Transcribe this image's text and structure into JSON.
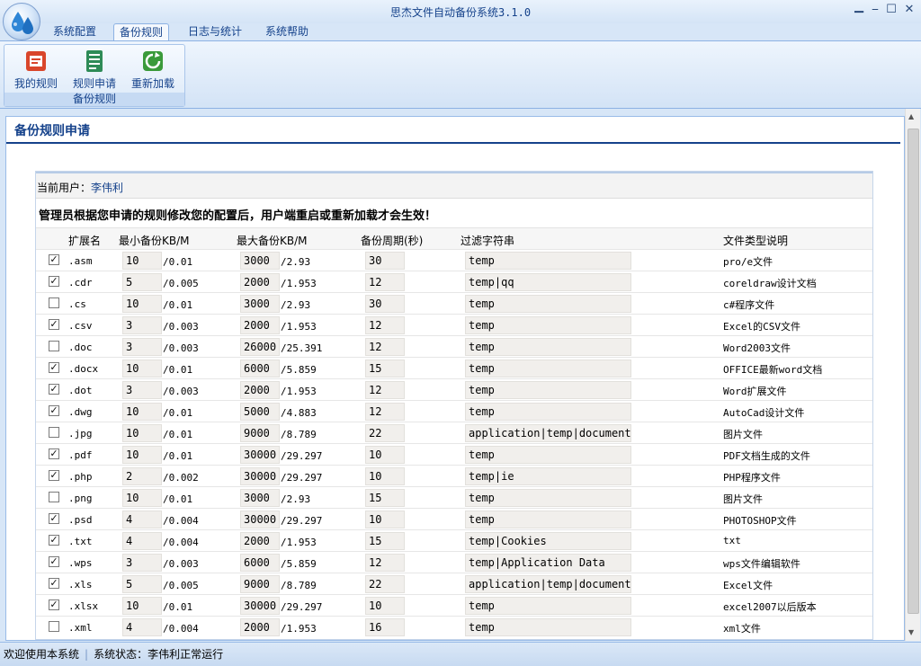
{
  "window": {
    "title": "思杰文件自动备份系统3.1.0"
  },
  "menu": {
    "tabs": [
      {
        "label": "系统配置",
        "active": false
      },
      {
        "label": "备份规则",
        "active": true
      },
      {
        "label": "日志与统计",
        "active": false
      },
      {
        "label": "系统帮助",
        "active": false
      }
    ]
  },
  "ribbon": {
    "group_label": "备份规则",
    "buttons": [
      {
        "label": "我的规则",
        "icon": "my-rules-icon"
      },
      {
        "label": "规则申请",
        "icon": "rule-apply-icon"
      },
      {
        "label": "重新加载",
        "icon": "reload-icon"
      }
    ]
  },
  "page": {
    "title": "备份规则申请",
    "user_label": "当前用户：",
    "user_name": "李伟利",
    "notice": "管理员根据您申请的规则修改您的配置后，用户端重启或重新加载才会生效！"
  },
  "table": {
    "headers": [
      "扩展名",
      "最小备份KB/M",
      "最大备份KB/M",
      "备份周期(秒)",
      "过滤字符串",
      "文件类型说明"
    ],
    "rows": [
      {
        "checked": true,
        "ext": ".asm",
        "min": "10",
        "min_m": "/0.01",
        "max": "3000",
        "max_m": "/2.93",
        "period": "30",
        "filter": "temp",
        "desc": "pro/e文件"
      },
      {
        "checked": true,
        "ext": ".cdr",
        "min": "5",
        "min_m": "/0.005",
        "max": "2000",
        "max_m": "/1.953",
        "period": "12",
        "filter": "temp|qq",
        "desc": "coreldraw设计文档"
      },
      {
        "checked": false,
        "ext": ".cs",
        "min": "10",
        "min_m": "/0.01",
        "max": "3000",
        "max_m": "/2.93",
        "period": "30",
        "filter": "temp",
        "desc": "c#程序文件"
      },
      {
        "checked": true,
        "ext": ".csv",
        "min": "3",
        "min_m": "/0.003",
        "max": "2000",
        "max_m": "/1.953",
        "period": "12",
        "filter": "temp",
        "desc": "Excel的CSV文件"
      },
      {
        "checked": false,
        "ext": ".doc",
        "min": "3",
        "min_m": "/0.003",
        "max": "26000",
        "max_m": "/25.391",
        "period": "12",
        "filter": "temp",
        "desc": "Word2003文件"
      },
      {
        "checked": true,
        "ext": ".docx",
        "min": "10",
        "min_m": "/0.01",
        "max": "6000",
        "max_m": "/5.859",
        "period": "15",
        "filter": "temp",
        "desc": "OFFICE最新word文档"
      },
      {
        "checked": true,
        "ext": ".dot",
        "min": "3",
        "min_m": "/0.003",
        "max": "2000",
        "max_m": "/1.953",
        "period": "12",
        "filter": "temp",
        "desc": "Word扩展文件"
      },
      {
        "checked": true,
        "ext": ".dwg",
        "min": "10",
        "min_m": "/0.01",
        "max": "5000",
        "max_m": "/4.883",
        "period": "12",
        "filter": "temp",
        "desc": "AutoCad设计文件"
      },
      {
        "checked": false,
        "ext": ".jpg",
        "min": "10",
        "min_m": "/0.01",
        "max": "9000",
        "max_m": "/8.789",
        "period": "22",
        "filter": "application|temp|document^",
        "desc": "图片文件"
      },
      {
        "checked": true,
        "ext": ".pdf",
        "min": "10",
        "min_m": "/0.01",
        "max": "30000",
        "max_m": "/29.297",
        "period": "10",
        "filter": "temp",
        "desc": "PDF文档生成的文件"
      },
      {
        "checked": true,
        "ext": ".php",
        "min": "2",
        "min_m": "/0.002",
        "max": "30000",
        "max_m": "/29.297",
        "period": "10",
        "filter": "temp|ie",
        "desc": "PHP程序文件"
      },
      {
        "checked": false,
        "ext": ".png",
        "min": "10",
        "min_m": "/0.01",
        "max": "3000",
        "max_m": "/2.93",
        "period": "15",
        "filter": "temp",
        "desc": "图片文件"
      },
      {
        "checked": true,
        "ext": ".psd",
        "min": "4",
        "min_m": "/0.004",
        "max": "30000",
        "max_m": "/29.297",
        "period": "10",
        "filter": "temp",
        "desc": "PHOTOSHOP文件"
      },
      {
        "checked": true,
        "ext": ".txt",
        "min": "4",
        "min_m": "/0.004",
        "max": "2000",
        "max_m": "/1.953",
        "period": "15",
        "filter": "temp|Cookies",
        "desc": "txt"
      },
      {
        "checked": true,
        "ext": ".wps",
        "min": "3",
        "min_m": "/0.003",
        "max": "6000",
        "max_m": "/5.859",
        "period": "12",
        "filter": "temp|Application Data",
        "desc": "wps文件编辑软件"
      },
      {
        "checked": true,
        "ext": ".xls",
        "min": "5",
        "min_m": "/0.005",
        "max": "9000",
        "max_m": "/8.789",
        "period": "22",
        "filter": "application|temp|document^",
        "desc": "Excel文件"
      },
      {
        "checked": true,
        "ext": ".xlsx",
        "min": "10",
        "min_m": "/0.01",
        "max": "30000",
        "max_m": "/29.297",
        "period": "10",
        "filter": "temp",
        "desc": "excel2007以后版本"
      },
      {
        "checked": false,
        "ext": ".xml",
        "min": "4",
        "min_m": "/0.004",
        "max": "2000",
        "max_m": "/1.953",
        "period": "16",
        "filter": "temp",
        "desc": "xml文件"
      }
    ]
  },
  "status": {
    "welcome": "欢迎使用本系统",
    "state": "系统状态：李伟利正常运行"
  },
  "colors": {
    "accent": "#15428b",
    "input_bg": "#f1efec"
  }
}
